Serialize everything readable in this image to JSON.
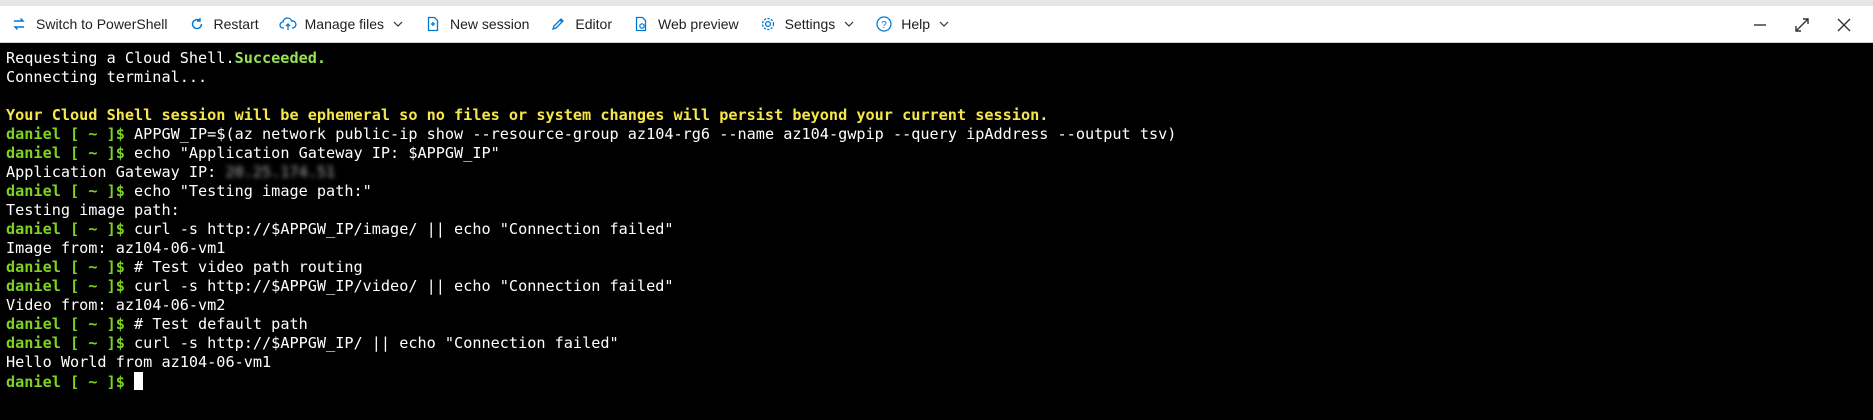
{
  "toolbar": {
    "switch_shell": "Switch to PowerShell",
    "restart": "Restart",
    "manage_files": "Manage files",
    "new_session": "New session",
    "editor": "Editor",
    "web_preview": "Web preview",
    "settings": "Settings",
    "help": "Help"
  },
  "terminal": {
    "prompt": "daniel [ ~ ]$",
    "lines": {
      "l1a": "Requesting a Cloud Shell.",
      "l1b": "Succeeded.",
      "l2": "Connecting terminal...",
      "l4": "Your Cloud Shell session will be ephemeral so no files or system changes will persist beyond your current session.",
      "c1": "APPGW_IP=$(az network public-ip show --resource-group az104-rg6 --name az104-gwpip --query ipAddress --output tsv)",
      "c2": "echo \"Application Gateway IP: $APPGW_IP\"",
      "o2a": "Application Gateway IP: ",
      "o2b": "20.25.174.51",
      "c3": "echo \"Testing image path:\"",
      "o3": "Testing image path:",
      "c4": "curl -s http://$APPGW_IP/image/ || echo \"Connection failed\"",
      "o4": "Image from: az104-06-vm1",
      "c5": "# Test video path routing",
      "c6": "curl -s http://$APPGW_IP/video/ || echo \"Connection failed\"",
      "o6": "Video from: az104-06-vm2",
      "c7": "# Test default path",
      "c8": "curl -s http://$APPGW_IP/ || echo \"Connection failed\"",
      "o8": "Hello World from az104-06-vm1"
    }
  },
  "colors": {
    "prompt": "#7ed321",
    "warning": "#f7e64a",
    "accent": "#0078d4"
  }
}
